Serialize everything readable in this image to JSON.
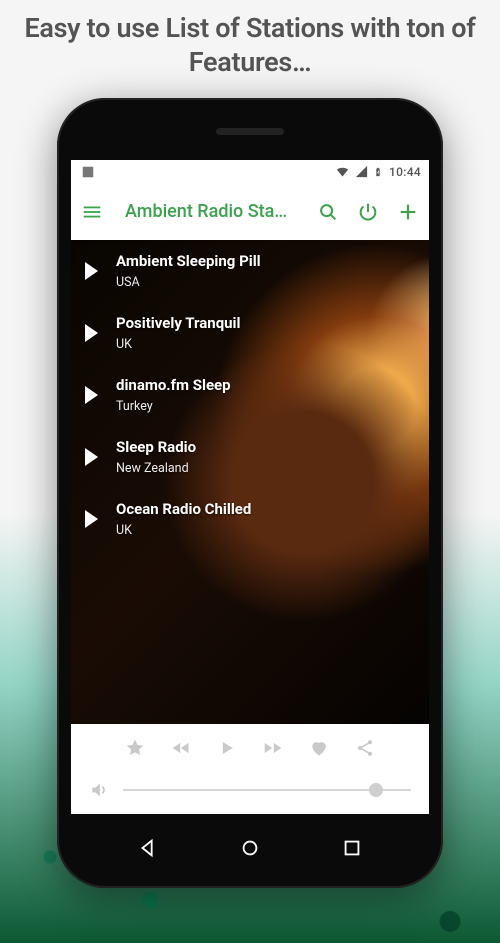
{
  "headline": "Easy to use List of Stations with ton of Features…",
  "statusbar": {
    "time": "10:44"
  },
  "appbar": {
    "title": "Ambient Radio Sta…"
  },
  "stations": [
    {
      "name": "Ambient Sleeping Pill",
      "location": "USA"
    },
    {
      "name": "Positively Tranquil",
      "location": "UK"
    },
    {
      "name": "dinamo.fm Sleep",
      "location": "Turkey"
    },
    {
      "name": "Sleep Radio",
      "location": "New Zealand"
    },
    {
      "name": "Ocean Radio Chilled",
      "location": "UK"
    }
  ],
  "volume": {
    "percent": 88
  }
}
